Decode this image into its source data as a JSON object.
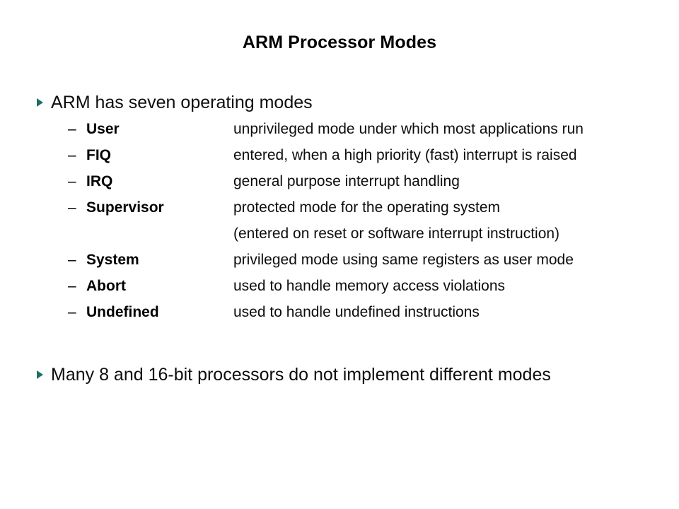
{
  "slide": {
    "title": "ARM Processor Modes",
    "background_color": "#FFFFFF",
    "text_color": "#000000",
    "bullet_color": "#1C6E68",
    "bullets": [
      {
        "marker": "triangle-bullet-icon",
        "text": "ARM has seven operating modes"
      },
      {
        "marker": "triangle-bullet-icon",
        "text": "Many 8 and 16-bit processors do not implement different modes"
      }
    ],
    "modes": [
      {
        "dash": "–",
        "term": "User",
        "description": "unprivileged mode under which most applications run"
      },
      {
        "dash": "–",
        "term": "FIQ",
        "description": "entered, when a high priority (fast) interrupt is raised"
      },
      {
        "dash": "–",
        "term": "IRQ",
        "description": "general purpose interrupt handling"
      },
      {
        "dash": "–",
        "term": "Supervisor",
        "description": "protected mode for the operating system"
      },
      {
        "dash": "",
        "term": "",
        "description": "(entered on reset or software interrupt instruction)"
      },
      {
        "dash": "–",
        "term": "System",
        "description": "privileged mode using same registers as user mode"
      },
      {
        "dash": "–",
        "term": "Abort",
        "description": "used to handle memory access violations"
      },
      {
        "dash": "–",
        "term": "Undefined",
        "description": "used to handle undefined instructions"
      }
    ]
  }
}
